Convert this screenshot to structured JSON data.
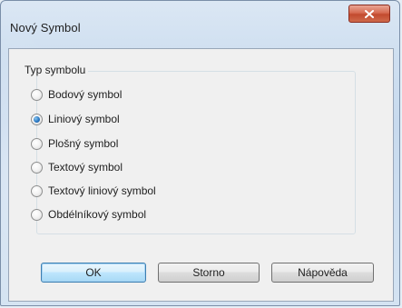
{
  "window": {
    "title": "Nový Symbol"
  },
  "group": {
    "label": "Typ symbolu",
    "options": [
      {
        "label": "Bodový symbol",
        "checked": false
      },
      {
        "label": "Liniový symbol",
        "checked": true
      },
      {
        "label": "Plošný symbol",
        "checked": false
      },
      {
        "label": "Textový symbol",
        "checked": false
      },
      {
        "label": "Textový liniový symbol",
        "checked": false
      },
      {
        "label": "Obdélníkový symbol",
        "checked": false
      }
    ]
  },
  "buttons": {
    "ok": "OK",
    "cancel": "Storno",
    "help": "Nápověda"
  },
  "colors": {
    "close_button": "#c9573b",
    "default_button_border": "#3c7fb1",
    "radio_checked": "#2a78c2"
  },
  "icons": {
    "close": "close-icon"
  }
}
